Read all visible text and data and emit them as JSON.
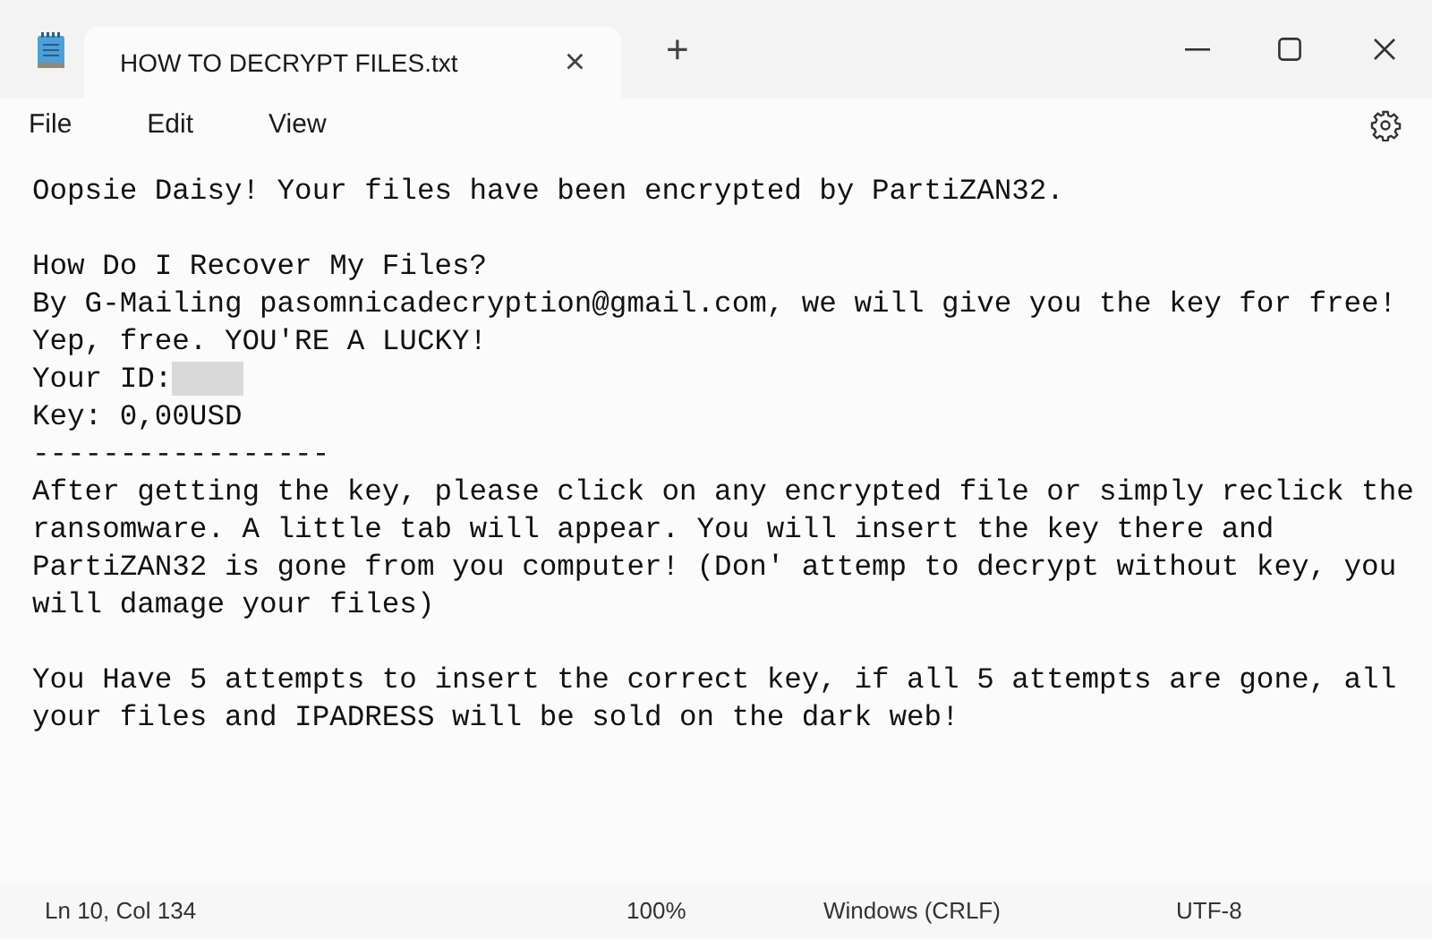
{
  "tab": {
    "title": "HOW TO DECRYPT FILES.txt",
    "close": "×",
    "new_tab": "+"
  },
  "menu": [
    "File",
    "Edit",
    "View"
  ],
  "document": {
    "paragraphs": [
      {
        "lines": [
          {
            "text": "Oopsie Daisy! Your files have been encrypted by PartiZAN32.",
            "redacted": false
          }
        ]
      },
      {
        "lines": [
          {
            "text": "How Do I Recover My Files?",
            "redacted": false
          },
          {
            "text": "By G-Mailing pasomnicadecryption@gmail.com, we will give you the key for free!",
            "redacted": false
          },
          {
            "text": "Yep, free. YOU'RE A LUCKY!",
            "redacted": false
          },
          {
            "text": "Your ID:",
            "redacted": true
          },
          {
            "text": "Key: 0,00USD",
            "redacted": false
          },
          {
            "text": "-----------------",
            "redacted": false
          },
          {
            "text": "After getting the key, please click on any encrypted file or simply reclick the",
            "redacted": false
          },
          {
            "text": "ransomware. A little tab will appear. You will insert the key there and",
            "redacted": false
          },
          {
            "text": "PartiZAN32 is gone from you computer! (Don' attemp to decrypt without key, you",
            "redacted": false
          },
          {
            "text": "will damage your files)",
            "redacted": false
          }
        ]
      },
      {
        "lines": [
          {
            "text": "You Have 5 attempts to insert the correct key, if all 5 attempts are gone, all",
            "redacted": false
          },
          {
            "text": "your files and IPADRESS will be sold on the dark web!",
            "redacted": false
          }
        ]
      }
    ]
  },
  "status_bar": {
    "position": "Ln 10, Col 134",
    "zoom": "100%",
    "line_endings": "Windows (CRLF)",
    "encoding": "UTF-8"
  }
}
